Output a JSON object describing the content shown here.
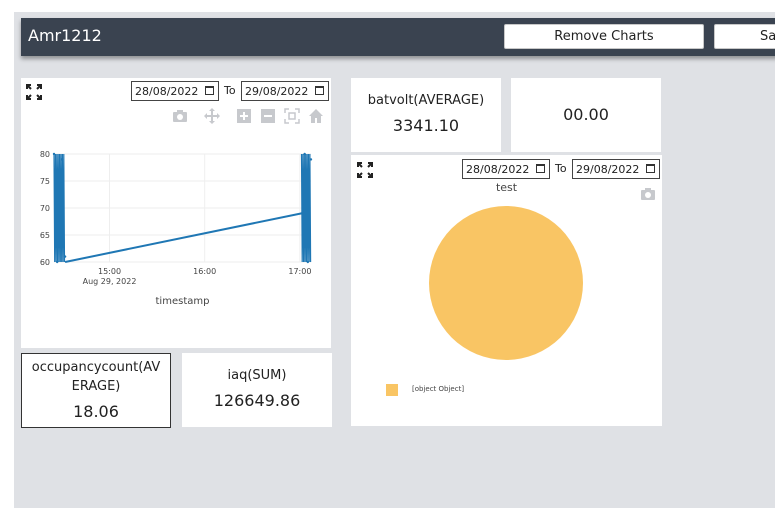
{
  "header": {
    "title": "Amr1212",
    "remove_charts_label": "Remove Charts",
    "save_label": "Save"
  },
  "line_chart_card": {
    "from_date": "28/08/2022",
    "to_label": "To",
    "to_date": "29/08/2022",
    "toolbar_icons": [
      "camera-icon",
      "pan-icon",
      "zoom-in-icon",
      "zoom-out-icon",
      "autoscale-icon",
      "home-icon"
    ]
  },
  "metrics": {
    "batvolt": {
      "label": "batvolt(AVERAGE)",
      "value": "3341.10"
    },
    "blank": {
      "value": "00.00"
    },
    "occupancy": {
      "label_line1": "occupancycount(AV",
      "label_line2": "ERAGE)",
      "value": "18.06"
    },
    "iaq": {
      "label": "iaq(SUM)",
      "value": "126649.86"
    }
  },
  "pie_chart_card": {
    "from_date": "28/08/2022",
    "to_label": "To",
    "to_date": "29/08/2022",
    "title": "test",
    "legend_label": "[object Object]",
    "color": "#f9c564"
  },
  "chart_data": [
    {
      "type": "line",
      "title": "",
      "xlabel": "timestamp",
      "ylabel": "",
      "x_ticks": [
        "15:00",
        "16:00",
        "17:00"
      ],
      "x_subtick": "Aug 29, 2022",
      "y_ticks": [
        60,
        65,
        70,
        75,
        80
      ],
      "ylim": [
        60,
        80
      ],
      "color": "#1f77b4",
      "series": [
        {
          "x": [
            "14:25",
            "14:27",
            "14:30",
            "14:32",
            "17:01",
            "17:03",
            "17:05",
            "17:07"
          ],
          "y": [
            80,
            60,
            79,
            61,
            69,
            80,
            60,
            79
          ]
        }
      ],
      "grid": true
    },
    {
      "type": "pie",
      "title": "test",
      "labels": [
        "[object Object]"
      ],
      "values": [
        100
      ],
      "colors": [
        "#f9c564"
      ]
    }
  ]
}
